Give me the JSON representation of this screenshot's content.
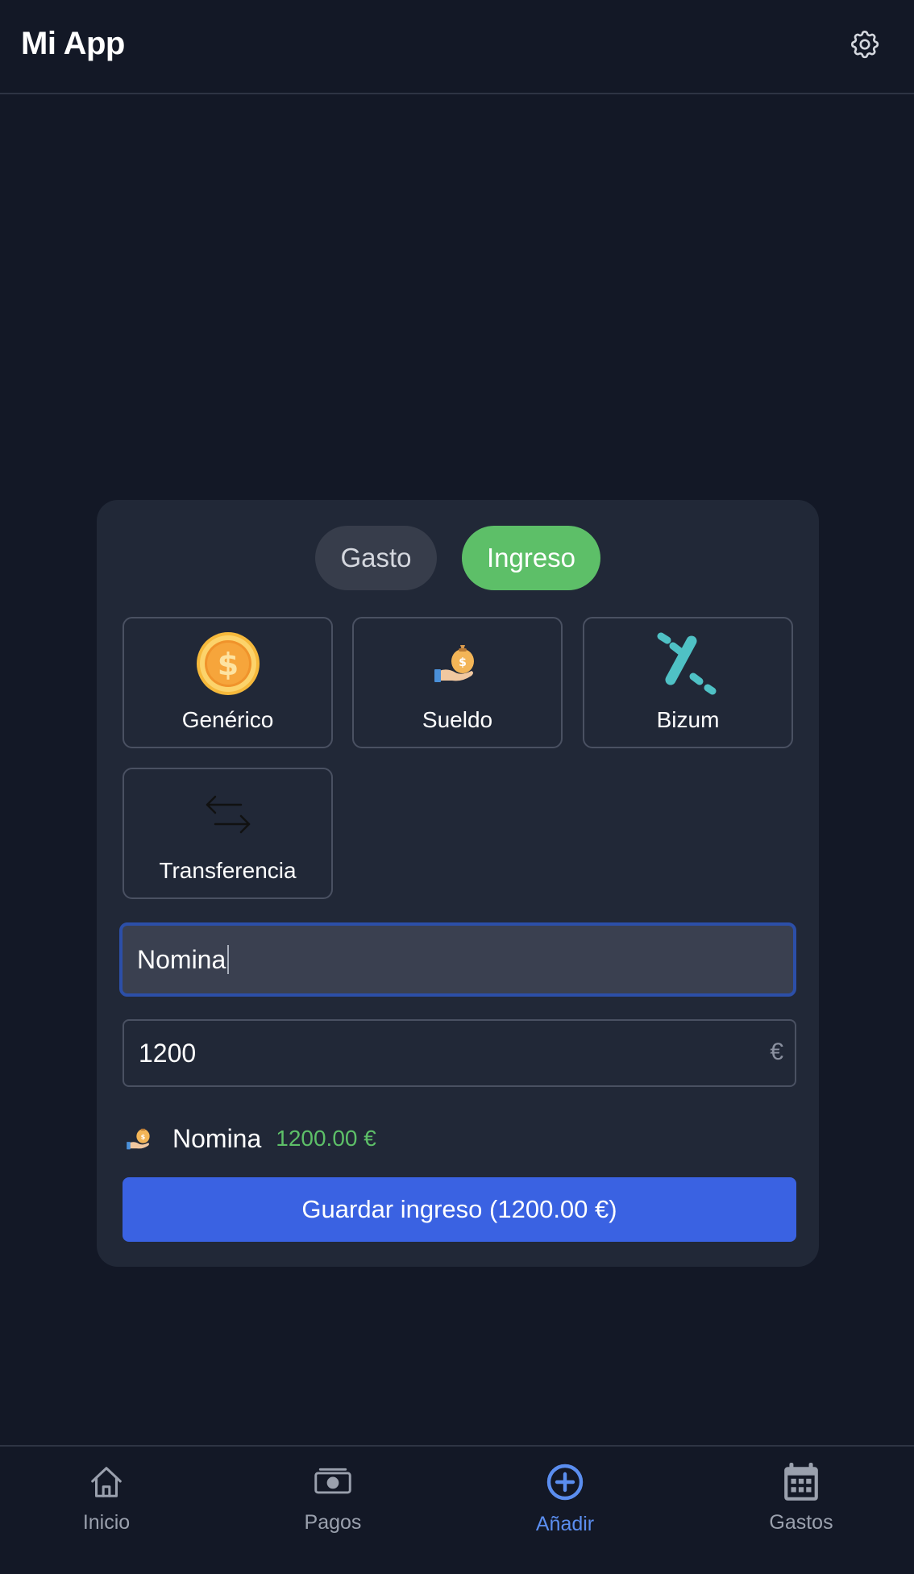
{
  "header": {
    "title": "Mi App",
    "settings_icon": "gear-icon"
  },
  "form": {
    "type_toggle": {
      "expense_label": "Gasto",
      "income_label": "Ingreso",
      "selected": "Ingreso"
    },
    "categories": [
      {
        "label": "Genérico",
        "icon": "coin-icon"
      },
      {
        "label": "Sueldo",
        "icon": "money-bag-hand-icon"
      },
      {
        "label": "Bizum",
        "icon": "bizum-logo-icon"
      },
      {
        "label": "Transferencia",
        "icon": "transfer-arrows-icon"
      }
    ],
    "description": {
      "value": "Nomina"
    },
    "amount": {
      "value": "1200",
      "currency": "€"
    },
    "preview": {
      "icon": "money-bag-hand-icon",
      "name": "Nomina",
      "amount": "1200.00 €"
    },
    "save_label": "Guardar ingreso (1200.00 €)"
  },
  "bottom_nav": {
    "active": "Añadir",
    "items": [
      {
        "label": "Inicio",
        "icon": "home-icon"
      },
      {
        "label": "Pagos",
        "icon": "banknote-icon"
      },
      {
        "label": "Añadir",
        "icon": "plus-circle-icon"
      },
      {
        "label": "Gastos",
        "icon": "calendar-icon"
      }
    ]
  },
  "colors": {
    "background": "#131826",
    "card": "#212837",
    "income_green": "#5dbf68",
    "primary_blue": "#3a62e2",
    "active_nav": "#5b8ef0"
  }
}
